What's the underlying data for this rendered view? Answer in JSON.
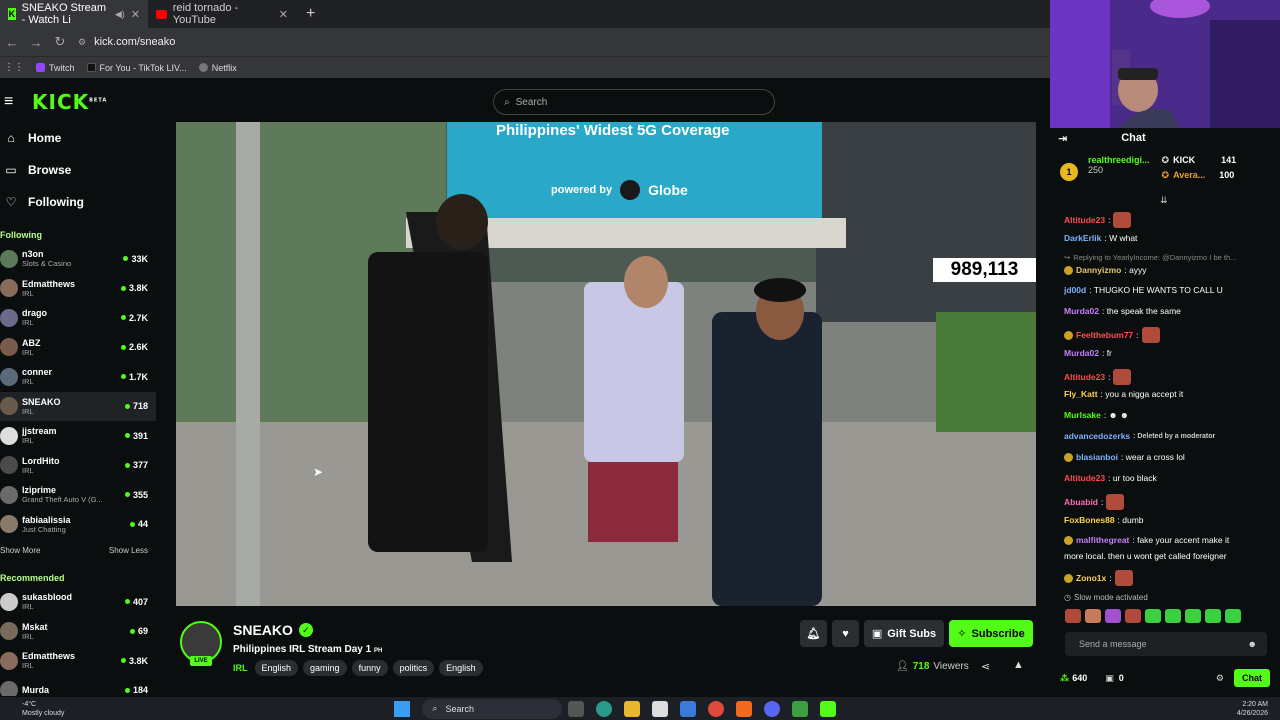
{
  "browser": {
    "tabs": [
      {
        "label": "SNEAKO Stream - Watch Li",
        "active": true
      },
      {
        "label": "reid tornado - YouTube",
        "active": false
      }
    ],
    "new_tab": "+",
    "url": "kick.com/sneako",
    "bookmarks": [
      "Twitch",
      "For You - TikTok LIV...",
      "Netflix"
    ]
  },
  "kick": {
    "logo": "KICK",
    "logo_beta": "BETA",
    "search_placeholder": "Search",
    "nav": [
      {
        "label": "Home",
        "icon": "home-icon"
      },
      {
        "label": "Browse",
        "icon": "browse-icon"
      },
      {
        "label": "Following",
        "icon": "heart-icon"
      }
    ],
    "following_header": "Following",
    "following": [
      {
        "name": "n3on",
        "category": "Slots & Casino",
        "viewers": "33K"
      },
      {
        "name": "Edmatthews",
        "category": "IRL",
        "viewers": "3.8K"
      },
      {
        "name": "drago",
        "category": "IRL",
        "viewers": "2.7K"
      },
      {
        "name": "ABZ",
        "category": "IRL",
        "viewers": "2.6K"
      },
      {
        "name": "conner",
        "category": "IRL",
        "viewers": "1.7K"
      },
      {
        "name": "SNEAKO",
        "category": "IRL",
        "viewers": "718"
      },
      {
        "name": "jjstream",
        "category": "IRL",
        "viewers": "391"
      },
      {
        "name": "LordHito",
        "category": "IRL",
        "viewers": "377"
      },
      {
        "name": "lziprime",
        "category": "Grand Theft Auto V (G...",
        "viewers": "355"
      },
      {
        "name": "fabiaalissia",
        "category": "Just Chatting",
        "viewers": "44"
      }
    ],
    "show_more": "Show More",
    "show_less": "Show Less",
    "recommended_header": "Recommended",
    "recommended": [
      {
        "name": "sukasblood",
        "category": "IRL",
        "viewers": "407"
      },
      {
        "name": "Mskat",
        "category": "IRL",
        "viewers": "69"
      },
      {
        "name": "Edmatthews",
        "category": "IRL",
        "viewers": "3.8K"
      },
      {
        "name": "Murda",
        "category": "",
        "viewers": "184"
      }
    ]
  },
  "video": {
    "billboard_text": "Philippines' Widest 5G Coverage",
    "billboard_sub": "powered by",
    "billboard_brand": "Globe",
    "counter": "989,113"
  },
  "stream": {
    "streamer": "SNEAKO",
    "live_badge": "LIVE",
    "title": "Philippines IRL Stream Day 1",
    "title_flag": "PH",
    "category": "IRL",
    "tags": [
      "English",
      "gaming",
      "funny",
      "politics",
      "English"
    ],
    "gift_subs": "Gift Subs",
    "subscribe": "Subscribe",
    "viewers_count": "718",
    "viewers_label": "Viewers"
  },
  "chat": {
    "title": "Chat",
    "leaderboard": {
      "rank": "1",
      "user": "realthreedigi...",
      "points": "250",
      "kick_label": "KICK",
      "kick_count": "141",
      "avera_label": "Avera...",
      "avera_count": "100"
    },
    "messages": [
      {
        "user": "Altitude23",
        "color": "#ff4d4d",
        "text": ":",
        "emote": true
      },
      {
        "user": "DarkErlik",
        "color": "#7fb2ff",
        "text": ": W what"
      },
      {
        "user": "",
        "color": "#888",
        "text": "Replying to YearlyIncome: @Dannyizmo I be th...",
        "reply": true
      },
      {
        "user": "Dannyizmo",
        "color": "#e8c66a",
        "text": ": ayyy",
        "badge": true
      },
      {
        "user": "jd00d",
        "color": "#7fb2ff",
        "text": ": THUGKO HE WANTS TO CALL U"
      },
      {
        "user": "Murda02",
        "color": "#c77dff",
        "text": ": the speak the same"
      },
      {
        "user": "Feelthebum77",
        "color": "#ff4d4d",
        "text": ":",
        "emote": true,
        "badge": true
      },
      {
        "user": "Murda02",
        "color": "#c77dff",
        "text": ": fr"
      },
      {
        "user": "Altitude23",
        "color": "#ff4d4d",
        "text": ":",
        "emote": true
      },
      {
        "user": "Fly_Katt",
        "color": "#ffd24d",
        "text": ": you a nigga accept it"
      },
      {
        "user": "Murlsake",
        "color": "#53fc18",
        "text": ": ☻ ☻"
      },
      {
        "user": "advancedozerks",
        "color": "#7fb2ff",
        "text": ": Deleted by a moderator",
        "deleted": true
      },
      {
        "user": "blasianboi",
        "color": "#7fb2ff",
        "text": ": wear a cross lol",
        "badge": true
      },
      {
        "user": "Altitude23",
        "color": "#ff4d4d",
        "text": ": ur too black"
      },
      {
        "user": "Abuabid",
        "color": "#ff6fb5",
        "text": ":",
        "emote": true
      },
      {
        "user": "FoxBones88",
        "color": "#ffd24d",
        "text": ": dumb"
      },
      {
        "user": "malfithegreat",
        "color": "#c77dff",
        "text": ": fake your accent make it",
        "badge": true
      },
      {
        "user": "",
        "color": "#fff",
        "text": "more local. then u wont get called foreigner"
      },
      {
        "user": "Zono1x",
        "color": "#ffd24d",
        "text": ":",
        "emote": true,
        "badge": true
      }
    ],
    "slow_mode": "Slow mode activated",
    "input_placeholder": "Send a message",
    "points": "640",
    "gift_count": "0",
    "chat_button": "Chat"
  },
  "taskbar": {
    "weather_temp": "-4°C",
    "weather_desc": "Mostly cloudy",
    "search": "Search",
    "time": "2:20 AM",
    "date": "4/26/2026"
  }
}
